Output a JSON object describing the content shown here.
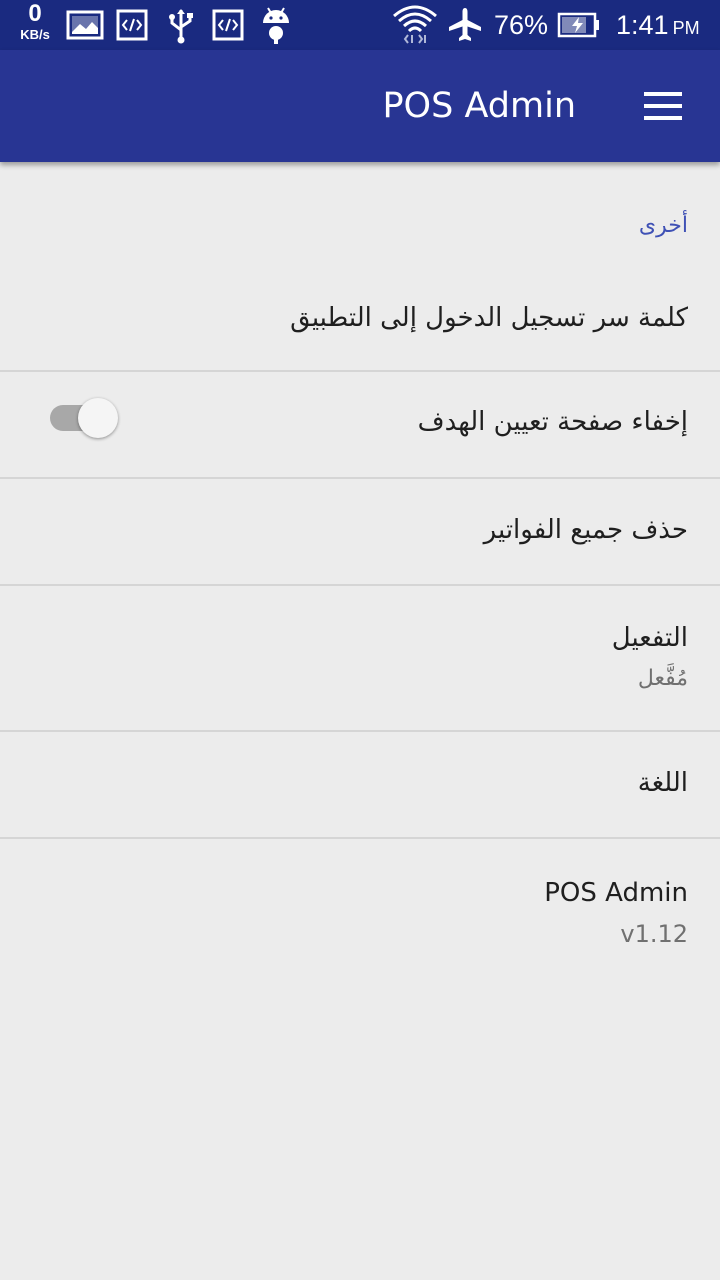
{
  "status_bar": {
    "speed_value": "0",
    "speed_unit": "KB/s",
    "icons": [
      "gallery-icon",
      "code-icon",
      "usb-icon",
      "code-icon",
      "android-icon",
      "wifi-icon",
      "airplane-mode-icon",
      "battery-charging-icon"
    ],
    "battery_percent": "76%",
    "time": "1:41",
    "ampm": "PM"
  },
  "toolbar": {
    "title": "POS Admin",
    "menu_icon": "hamburger-menu-icon"
  },
  "settings": {
    "section_header": "أخرى",
    "items": [
      {
        "title": "كلمة سر تسجيل الدخول إلى التطبيق"
      },
      {
        "title": "إخفاء صفحة تعيين الهدف",
        "switch_on": false
      },
      {
        "title": "حذف جميع الفواتير"
      },
      {
        "title": "التفعيل",
        "summary": "مُفَّعل"
      },
      {
        "title": "اللغة"
      },
      {
        "title": "POS Admin",
        "summary": "v1.12"
      }
    ]
  },
  "colors": {
    "status_bar": "#1a2a80",
    "toolbar": "#283593",
    "accent": "#3f51b5",
    "background": "#ececec",
    "divider": "#d5d5d5"
  }
}
